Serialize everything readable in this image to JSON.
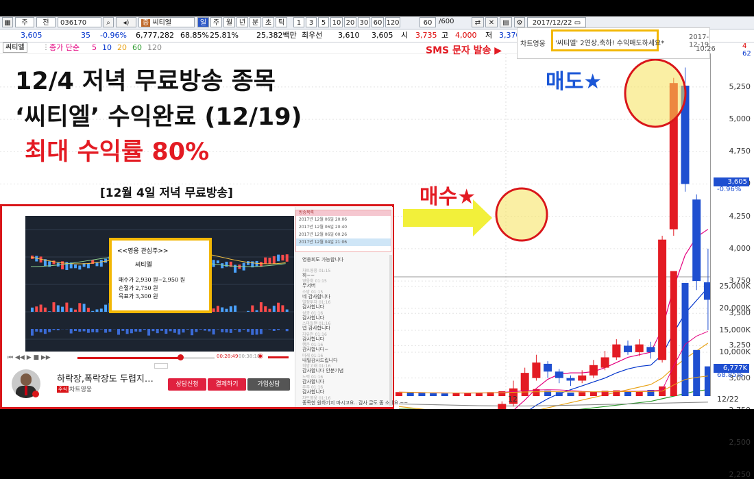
{
  "toolbar": {
    "code": "036170",
    "stock_name": "씨티엘",
    "radio_1": "주",
    "radio_2": "전",
    "period_tabs": [
      "일",
      "주",
      "월",
      "년",
      "분",
      "초",
      "틱"
    ],
    "minute_intervals": [
      "1",
      "3",
      "5",
      "10",
      "20",
      "30",
      "60",
      "120"
    ],
    "count_value": "60",
    "count_total": "/600",
    "date": "2017/12/22"
  },
  "quote": {
    "price": "3,605",
    "change": "35",
    "change_pct": "-0.96%",
    "volume": "6,777,282",
    "ratio_1": "68.85%",
    "ratio_2": "25.81%",
    "amount": "25,382백만",
    "preferred_label": "최우선",
    "bid": "3,610",
    "ask": "3,605",
    "open_label": "시",
    "open": "3,735",
    "high_label": "고",
    "high": "4,000",
    "low_label": "저",
    "low": "3,370"
  },
  "chart": {
    "stock_tag": "씨티엘",
    "indicator_label": "종가 단순",
    "ma_periods": [
      "5",
      "10",
      "20",
      "60",
      "120"
    ],
    "ma_colors": [
      "#e4007f",
      "#0033cc",
      "#e8a317",
      "#2d9a2d",
      "#888888"
    ],
    "price_ticks": [
      "5,250",
      "5,000",
      "4,750",
      "4,500",
      "4,250",
      "4,000",
      "3,750",
      "3,500",
      "3,250",
      "3,000",
      "2,750",
      "2,500",
      "2,250"
    ],
    "price_tag": "3,605",
    "price_tag_pct": "-0.96%",
    "volume_ticks": [
      "25,000K",
      "20,000K",
      "15,000K",
      "10,000K"
    ],
    "volume_tag": "6,777K",
    "volume_tag_pct": "68.85%",
    "x_label_12": "12",
    "x_label_end": "12/22",
    "corner_values": [
      "4",
      "62"
    ]
  },
  "headline": {
    "line1": "12/4 저녁 무료방송 종목",
    "line2": "‘씨티엘’ 수익완료 (12/19)",
    "line3": "최대 수익률 80%",
    "caption": "[12월 4일 저녁 무료방송]",
    "sms_label": "SMS 문자 발송 ▶",
    "sell_label": "매도★",
    "buy_label": "매수★"
  },
  "sms": {
    "sender": "차트영웅",
    "message": "'씨티엘' 2연상,축하! 수익매도하세요*",
    "date": "2017-12-19",
    "time": "10:26"
  },
  "video": {
    "note_title": "<<영웅 관심주>>",
    "note_stock": "씨티엘",
    "buy_label": "매수가",
    "buy_value": "2,930 원~2,950 원",
    "stop_label": "손절가",
    "stop_value": "2,750 원",
    "target_label": "목표가",
    "target_value": "3,300 원",
    "time_current": "00:28:49",
    "time_total": "00:38:18",
    "broadcast_title": "하락장,폭락장도 두렵지…",
    "channel_tag": "주식",
    "channel_name": "차트영웅",
    "btn_consult": "상담신청",
    "btn_pay": "결제하기",
    "btn_join": "가입상담"
  },
  "chat": {
    "header": "방송목록",
    "list": [
      "2017년 12월 06일 20:06",
      "2017년 12월 06일 20:40",
      "2017년 12월 06일 00:26",
      "2017년 12월 04일 21:06"
    ],
    "messages": [
      {
        "name": "",
        "text": "영웅회도 가능합니다"
      },
      {
        "name": "차트영웅 01:15",
        "text": "하~~"
      },
      {
        "name": "영웅회 01:15",
        "text": "무서버"
      },
      {
        "name": "소망 01:15",
        "text": "네 감사합니다"
      },
      {
        "name": "열정투자 01:16",
        "text": "감사합니다"
      },
      {
        "name": "성공 01:16",
        "text": "감사합니다"
      },
      {
        "name": "스마일맨 01:16",
        "text": "넵 감사합니다"
      },
      {
        "name": "자유인 01:16",
        "text": "감사합니다"
      },
      {
        "name": "행운 01:16",
        "text": "감사합니다~"
      },
      {
        "name": "미래 01:16",
        "text": "내일감사드립니다"
      },
      {
        "name": "희망고래 01:16",
        "text": "감사합니다 안분기념"
      },
      {
        "name": "노력 01:16",
        "text": "감사합니다"
      },
      {
        "name": "주주 01:16",
        "text": "감사합니다"
      },
      {
        "name": "차트영웅 01:16",
        "text": "종목한 원하기지 마시고요.. 감사 글도 좀 소세요 ~~"
      }
    ]
  }
}
